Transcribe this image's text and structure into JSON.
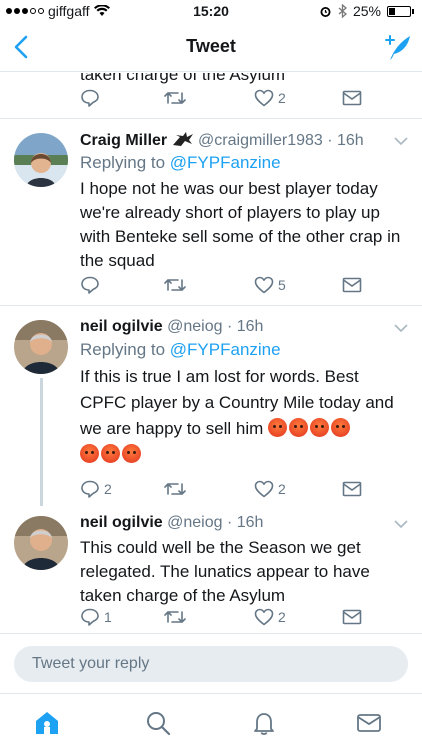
{
  "status_bar": {
    "carrier": "giffgaff",
    "time": "15:20",
    "battery": "25%",
    "battery_level": 0.25
  },
  "header": {
    "title": "Tweet",
    "back_icon": "chevron-left-icon",
    "compose_icon": "compose-feather-icon"
  },
  "partial_tweet": {
    "cut_text": "taken charge of the Asylum",
    "actions": {
      "reply": "",
      "retweet": "",
      "like": "2",
      "message": ""
    }
  },
  "tweets": [
    {
      "name": "Craig Miller",
      "handle": "@craigmiller1983",
      "time": "· 16h",
      "replying_prefix": "Replying to ",
      "replying_to": "@FYPFanzine",
      "text": "I hope not he was our best player today we're already short of players to play up with Benteke sell some of the other crap in the squad",
      "actions": {
        "reply": "",
        "retweet": "",
        "like": "5",
        "message": ""
      }
    },
    {
      "name": "neil ogilvie",
      "handle": "@neiog",
      "time": "· 16h",
      "replying_prefix": "Replying to ",
      "replying_to": "@FYPFanzine",
      "text": "If this is true I am lost for words. Best CPFC player by a Country Mile today and we are happy to sell him",
      "actions": {
        "reply": "2",
        "retweet": "",
        "like": "2",
        "message": ""
      }
    },
    {
      "name": "neil ogilvie",
      "handle": "@neiog",
      "time": "· 16h",
      "text": "This could well be the Season we get relegated. The lunatics appear to have taken charge of the Asylum",
      "actions": {
        "reply": "1",
        "retweet": "",
        "like": "2",
        "message": ""
      }
    }
  ],
  "composer": {
    "placeholder": "Tweet your reply"
  },
  "tab_bar": {
    "items": [
      "home-icon",
      "search-icon",
      "notifications-bell-icon",
      "messages-envelope-icon"
    ],
    "active": "home-icon"
  },
  "colors": {
    "accent": "#1da1f2",
    "secondary_text": "#657786",
    "divider": "#e1e8ed"
  }
}
